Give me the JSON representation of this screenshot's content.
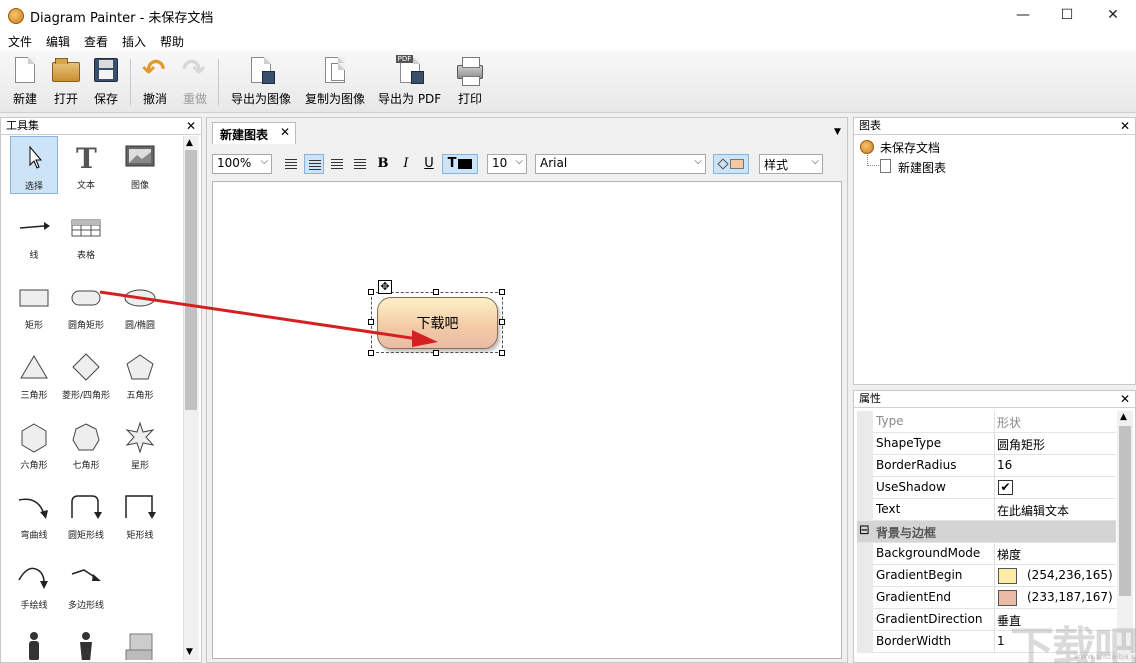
{
  "window": {
    "title": "Diagram Painter - 未保存文档",
    "controls": {
      "minimize": "—",
      "maximize": "☐",
      "close": "✕"
    }
  },
  "menubar": {
    "items": [
      "文件",
      "编辑",
      "查看",
      "插入",
      "帮助"
    ]
  },
  "toolbar": {
    "new_label": "新建",
    "open_label": "打开",
    "save_label": "保存",
    "undo_label": "撤消",
    "redo_label": "重做",
    "export_image_label": "导出为图像",
    "copy_image_label": "复制为图像",
    "export_pdf_label": "导出为 PDF",
    "print_label": "打印",
    "pdf_tag": "PDF"
  },
  "toolpanel": {
    "title": "工具集",
    "close": "✕",
    "tools": [
      {
        "label": "选择"
      },
      {
        "label": "文本"
      },
      {
        "label": "图像"
      },
      {
        "label": "线"
      },
      {
        "label": "表格"
      },
      {
        "label": "矩形"
      },
      {
        "label": "圆角矩形"
      },
      {
        "label": "圆/椭圆"
      },
      {
        "label": "三角形"
      },
      {
        "label": "菱形/四角形"
      },
      {
        "label": "五角形"
      },
      {
        "label": "六角形"
      },
      {
        "label": "七角形"
      },
      {
        "label": "星形"
      },
      {
        "label": "弯曲线"
      },
      {
        "label": "圆矩形线"
      },
      {
        "label": "矩形线"
      },
      {
        "label": "手绘线"
      },
      {
        "label": "多边形线"
      }
    ]
  },
  "document": {
    "tab_label": "新建图表",
    "tab_close": "✕",
    "format": {
      "zoom": "100%",
      "font_size": "10",
      "font_family": "Arial",
      "style": "样式",
      "bold": "B",
      "italic": "I",
      "underline": "U",
      "text_color_label": "T"
    },
    "shape_text": "下载吧"
  },
  "chartpanel": {
    "title": "图表",
    "close": "✕",
    "root": "未保存文档",
    "child": "新建图表"
  },
  "properties": {
    "title": "属性",
    "close": "✕",
    "rows": [
      {
        "key": "Type",
        "value": "形状"
      },
      {
        "key": "ShapeType",
        "value": "圆角矩形"
      },
      {
        "key": "BorderRadius",
        "value": "16"
      },
      {
        "key": "UseShadow",
        "value": "✔"
      },
      {
        "key": "Text",
        "value": "在此编辑文本"
      },
      {
        "key": "背景与边框",
        "value": "",
        "group": true,
        "toggle": "⊟"
      },
      {
        "key": "BackgroundMode",
        "value": "梯度"
      },
      {
        "key": "GradientBegin",
        "value": "(254,236,165)",
        "swatch": "#feeca5"
      },
      {
        "key": "GradientEnd",
        "value": "(233,187,167)",
        "swatch": "#e9bba7"
      },
      {
        "key": "GradientDirection",
        "value": "垂直"
      },
      {
        "key": "BorderWidth",
        "value": "1"
      }
    ]
  },
  "colors": {
    "gradient_begin": "#feeca5",
    "gradient_end": "#e9bba7",
    "selection": "#cde3f7",
    "arrow": "#d42020"
  },
  "watermark": {
    "text": "下载吧",
    "sub": "www.xiazaiba.com"
  }
}
